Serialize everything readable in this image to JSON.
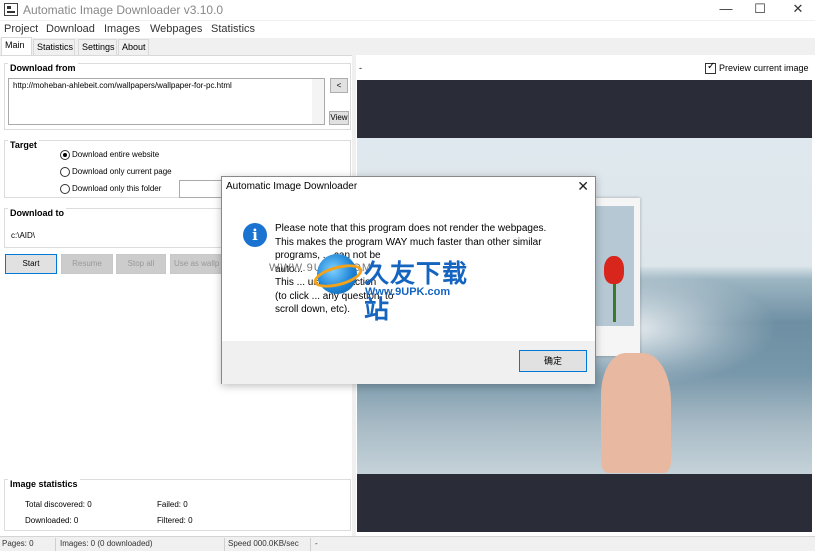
{
  "window": {
    "title": "Automatic Image Downloader  v3.10.0",
    "minimize": "—",
    "maximize": "☐",
    "close": "✕"
  },
  "menu": [
    "Project",
    "Download",
    "Images",
    "Webpages",
    "Statistics"
  ],
  "tabs": [
    "Main",
    "Statistics",
    "Settings",
    "About"
  ],
  "download_from": {
    "label": "Download from",
    "url": "http://moheban-ahlebeit.com/wallpapers/wallpaper-for-pc.html",
    "back_button": "<",
    "view_button": "View"
  },
  "target": {
    "label": "Target",
    "options": [
      "Download entire website",
      "Download only current page",
      "Download only this folder"
    ],
    "selected": 0
  },
  "download_to": {
    "label": "Download to",
    "path": "c:\\AID\\"
  },
  "buttons": {
    "start": "Start",
    "resume": "Resume",
    "stop_all": "Stop all",
    "use_as": "Use as wallp"
  },
  "image_statistics": {
    "label": "Image statistics",
    "total_discovered": "Total discovered: 0",
    "failed": "Failed: 0",
    "downloaded": "Downloaded: 0",
    "filtered": "Filtered: 0"
  },
  "preview": {
    "header": "-",
    "checkbox_label": "Preview current image",
    "checked": true
  },
  "status_bar": {
    "pages": "Pages: 0",
    "images": "Images: 0 (0 downloaded)",
    "speed": "Speed 000.0KB/sec",
    "extra": "-"
  },
  "dialog": {
    "title": "Automatic Image Downloader",
    "close": "✕",
    "message": [
      "Please note that this program does not render the webpages.",
      "This makes the program WAY much faster than other similar",
      "programs, ... can not be",
      "auto...",
      "This ... user interaction",
      "(to click ... any question, to",
      "scroll down, etc)."
    ],
    "ok_button": "确定"
  },
  "watermark": {
    "cn_text": "久友下载站",
    "url": "Www.9UPK.com",
    "overlay": "WWW.9UPK.COM"
  },
  "colors": {
    "accent": "#0078d7",
    "info_icon": "#1a73d0",
    "preview_bg": "#2a2d37",
    "watermark_blue": "#1565c0"
  }
}
